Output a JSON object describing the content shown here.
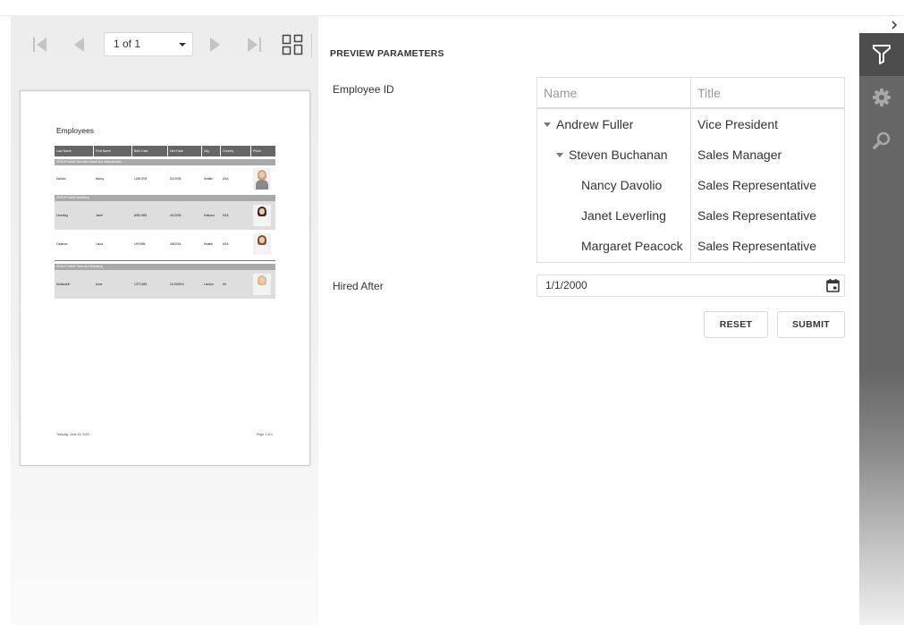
{
  "toolbar": {
    "page_selector_value": "1 of 1"
  },
  "report_preview": {
    "title": "Employees",
    "columns": [
      "Last Name",
      "First Name",
      "Birth Date",
      "Hire Date",
      "City",
      "Country",
      "Photo"
    ],
    "groups": [
      {
        "label": "GROUP NAME   Executive Board And Administration",
        "rows": [
          {
            "cells": [
              "Davolio",
              "Nancy",
              "12/8/1978",
              "5/1/2005",
              "Seattle",
              "USA"
            ]
          }
        ]
      },
      {
        "label": "GROUP NAME   Marketing",
        "rows": [
          {
            "cells": [
              "Leverling",
              "Janet",
              "8/30/1983",
              "4/1/2005",
              "Kirkland",
              "USA"
            ]
          },
          {
            "cells": [
              "Callahan",
              "Laura",
              "1/9/1985",
              "3/5/2004",
              "Seattle",
              "USA"
            ]
          }
        ]
      },
      {
        "label": "GROUP NAME   Sales and Marketing",
        "rows": [
          {
            "cells": [
              "Dodsworth",
              "Anne",
              "1/27/1983",
              "11/15/2004",
              "London",
              "UK"
            ]
          }
        ]
      }
    ],
    "footer_date": "Tuesday, June 15, 2021",
    "footer_page": "Page 1 of 1"
  },
  "parameters": {
    "title": "PREVIEW PARAMETERS",
    "employee_label": "Employee ID",
    "grid": {
      "headers": {
        "name": "Name",
        "title": "Title"
      },
      "rows": [
        {
          "name": "Andrew Fuller",
          "title": "Vice President"
        },
        {
          "name": "Steven Buchanan",
          "title": "Sales Manager"
        },
        {
          "name": "Nancy Davolio",
          "title": "Sales Representative"
        },
        {
          "name": "Janet Leverling",
          "title": "Sales Representative"
        },
        {
          "name": "Margaret Peacock",
          "title": "Sales Representative"
        }
      ]
    },
    "hired_label": "Hired After",
    "hired_value": "1/1/2000",
    "reset_label": "RESET",
    "submit_label": "SUBMIT"
  },
  "tabs": [
    {
      "icon": "filter-icon",
      "active": true
    },
    {
      "icon": "gear-icon",
      "active": false
    },
    {
      "icon": "search-icon",
      "active": false
    }
  ],
  "colors": {
    "tab_strip": "#666666",
    "active_tab": "#4d4d4d",
    "report_header": "#666666",
    "group_band": "#a9a9a9"
  }
}
